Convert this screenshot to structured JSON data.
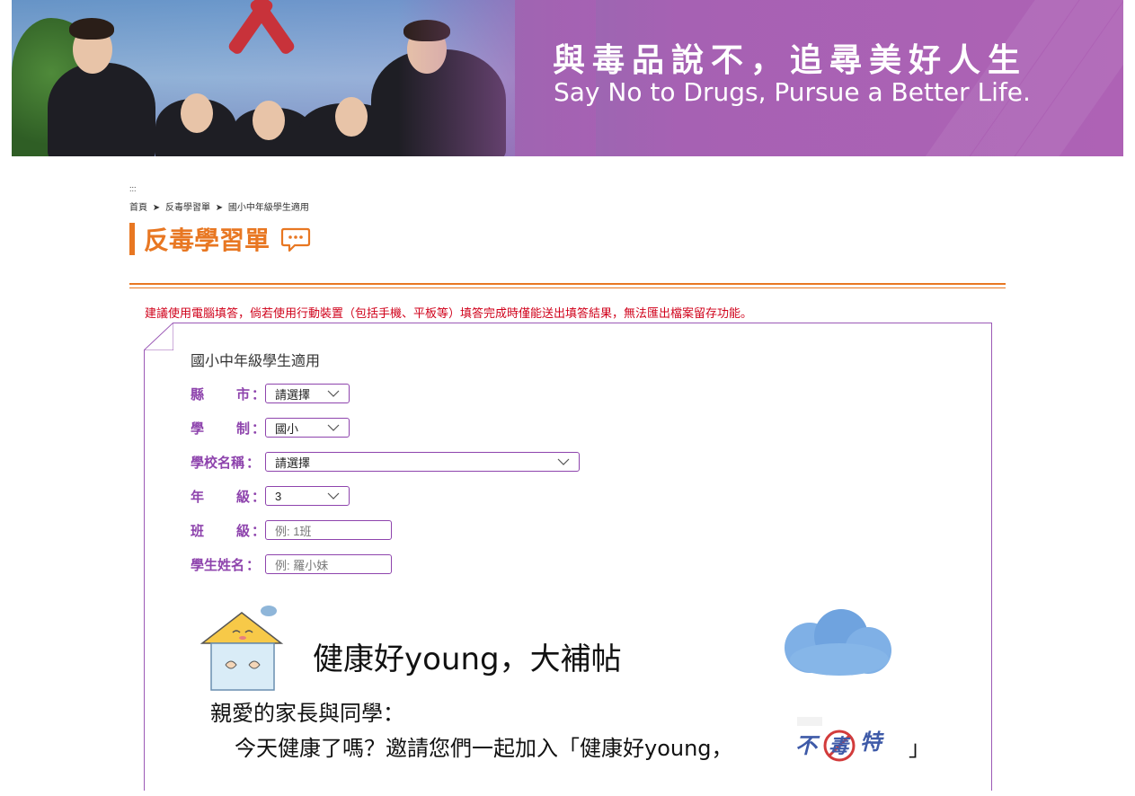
{
  "banner": {
    "title_zh": "與毒品說不，追尋美好人生",
    "title_en": "Say No to Drugs, Pursue a Better Life."
  },
  "skip_link": ":::",
  "breadcrumb": [
    "首頁",
    "➤",
    "反毒學習單",
    "➤",
    "國小中年級學生適用"
  ],
  "page_title": "反毒學習單",
  "notice": "建議使用電腦填答，倘若使用行動裝置（包括手機、平板等）填答完成時僅能送出填答結果，無法匯出檔案留存功能。",
  "form": {
    "heading": "國小中年級學生適用",
    "fields": {
      "city": {
        "label_a": "縣",
        "label_b": "市",
        "value": "請選擇"
      },
      "school_type": {
        "label_a": "學",
        "label_b": "制",
        "value": "國小"
      },
      "school_name": {
        "label": "學校名稱",
        "value": "請選擇"
      },
      "grade": {
        "label_a": "年",
        "label_b": "級",
        "value": "3"
      },
      "class": {
        "label_a": "班",
        "label_b": "級",
        "placeholder": "例: 1班"
      },
      "student_name": {
        "label": "學生姓名",
        "placeholder": "例: 羅小妹"
      }
    },
    "colon": "："
  },
  "poster": {
    "title": "健康好young，大補帖",
    "greeting": "親愛的家長與同學：",
    "invite": "今天健康了嗎？邀請您們一起加入「健康好young，",
    "bracket_close": "」",
    "logo_text": "不毒特"
  },
  "colors": {
    "accent": "#e87722",
    "form_purple": "#8e44ad",
    "notice_red": "#d0021b",
    "banner_purple": "#a661b3"
  },
  "icons": [
    "chat-bubble-icon",
    "chevron-down-icon",
    "house-mascot-icon",
    "cloud-icon"
  ]
}
